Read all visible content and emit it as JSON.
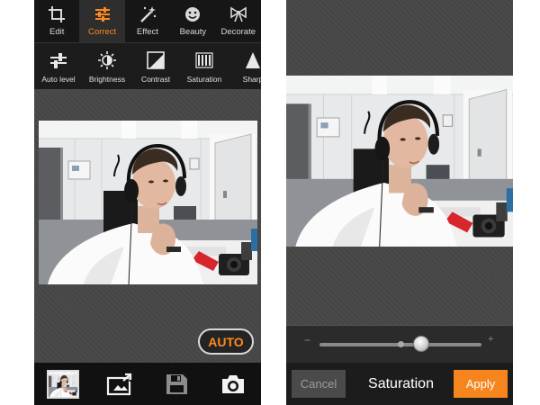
{
  "left_screen": {
    "tabs": [
      {
        "label": "Edit",
        "icon": "crop-icon",
        "active": false
      },
      {
        "label": "Correct",
        "icon": "sliders-icon",
        "active": true
      },
      {
        "label": "Effect",
        "icon": "magic-wand-icon",
        "active": false
      },
      {
        "label": "Beauty",
        "icon": "smiley-icon",
        "active": false
      },
      {
        "label": "Decorate",
        "icon": "bow-icon",
        "active": false
      }
    ],
    "tools": [
      {
        "label": "Auto level",
        "icon": "auto-level-icon"
      },
      {
        "label": "Brightness",
        "icon": "sun-icon"
      },
      {
        "label": "Contrast",
        "icon": "contrast-icon"
      },
      {
        "label": "Saturation",
        "icon": "saturation-icon"
      },
      {
        "label": "Sharp",
        "icon": "sharpness-icon"
      }
    ],
    "auto_button": "AUTO",
    "bottom_bar": [
      "gallery-thumbnail",
      "share-image-icon",
      "save-icon",
      "camera-icon"
    ]
  },
  "right_screen": {
    "slider": {
      "minus": "−",
      "plus": "+",
      "value": 0.63
    },
    "cancel": "Cancel",
    "title": "Saturation",
    "apply": "Apply"
  },
  "colors": {
    "accent": "#ff8a1c",
    "apply": "#f7851d",
    "bar": "#161616",
    "background": "#4a4a4a"
  }
}
